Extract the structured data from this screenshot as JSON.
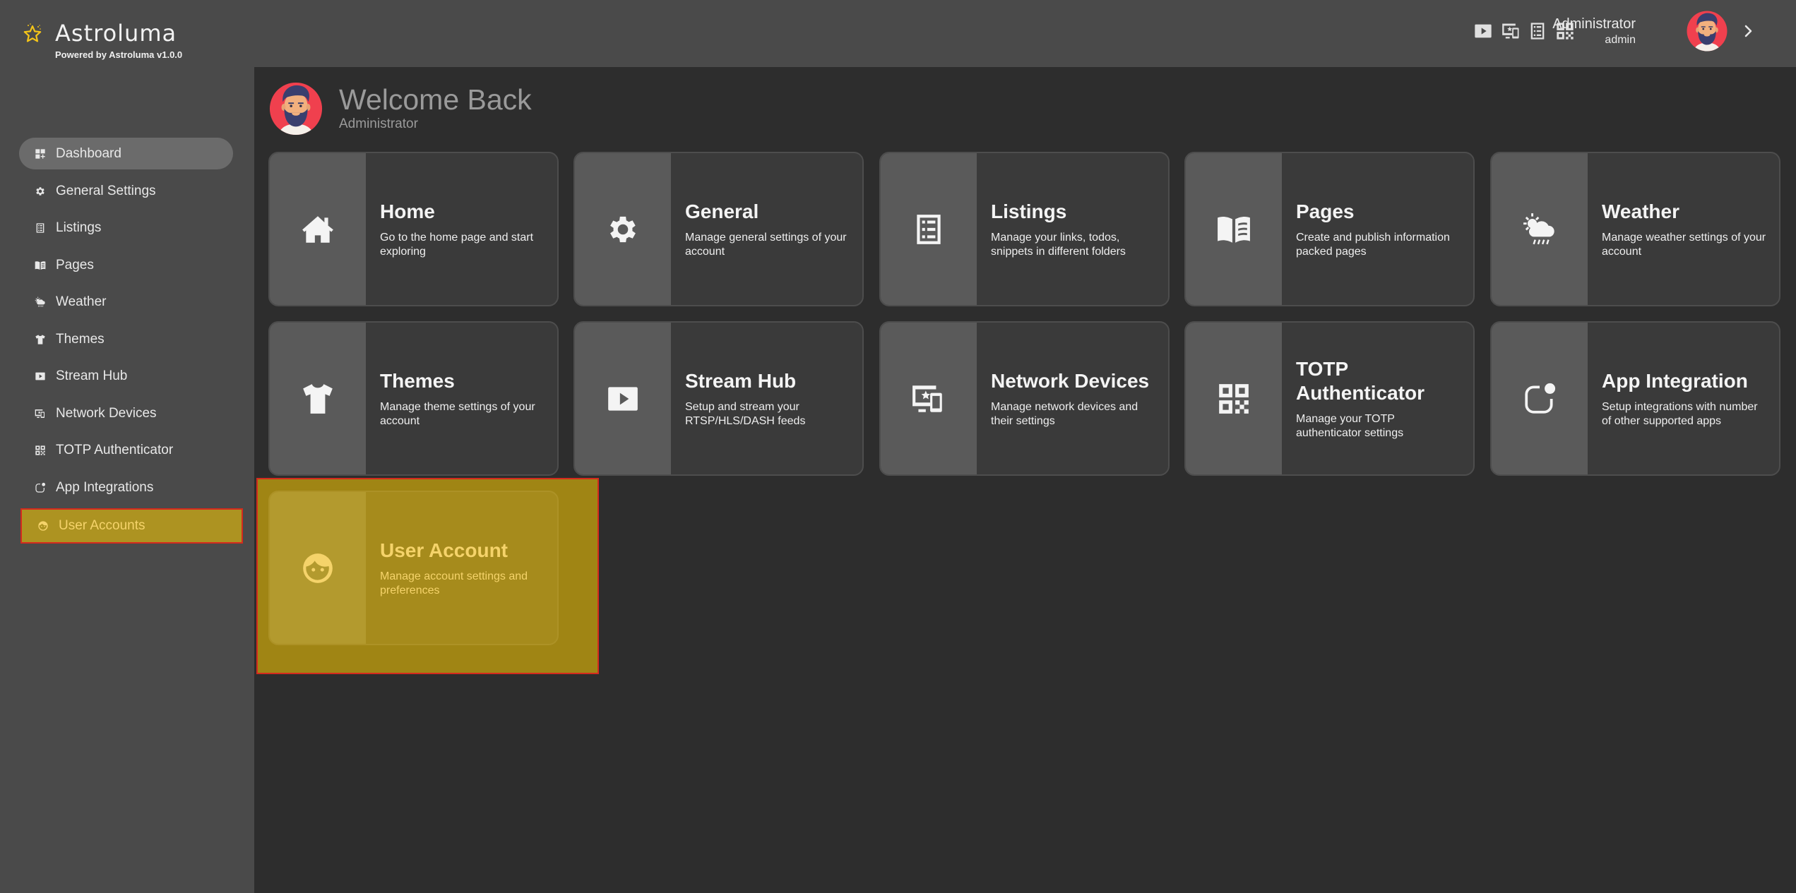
{
  "brand": {
    "title": "Astroluma",
    "subtitle": "Powered by Astroluma v1.0.0",
    "accent_color": "#f5c518"
  },
  "header": {
    "icons": [
      "stream-hub-icon",
      "network-devices-icon",
      "listings-icon",
      "qr-code-icon"
    ],
    "user_name": "Administrator",
    "user_role": "admin"
  },
  "sidebar": {
    "items": [
      {
        "label": "Dashboard",
        "icon": "dashboard-icon",
        "state": "active"
      },
      {
        "label": "General Settings",
        "icon": "gear-icon"
      },
      {
        "label": "Listings",
        "icon": "list-icon"
      },
      {
        "label": "Pages",
        "icon": "book-icon"
      },
      {
        "label": "Weather",
        "icon": "weather-icon"
      },
      {
        "label": "Themes",
        "icon": "tshirt-icon"
      },
      {
        "label": "Stream Hub",
        "icon": "play-icon"
      },
      {
        "label": "Network Devices",
        "icon": "devices-icon"
      },
      {
        "label": "TOTP Authenticator",
        "icon": "qr-code-icon"
      },
      {
        "label": "App Integrations",
        "icon": "app-integration-icon"
      },
      {
        "label": "User Accounts",
        "icon": "face-icon",
        "state": "highlighted"
      }
    ]
  },
  "welcome": {
    "title": "Welcome Back",
    "subtitle": "Administrator"
  },
  "cards": [
    {
      "title": "Home",
      "desc": "Go to the home page and start exploring",
      "icon": "home-icon"
    },
    {
      "title": "General",
      "desc": "Manage general settings of your account",
      "icon": "gear-icon"
    },
    {
      "title": "Listings",
      "desc": "Manage your links, todos, snippets in different folders",
      "icon": "list-icon"
    },
    {
      "title": "Pages",
      "desc": "Create and publish information packed pages",
      "icon": "book-icon"
    },
    {
      "title": "Weather",
      "desc": "Manage weather settings of your account",
      "icon": "weather-icon"
    },
    {
      "title": "Themes",
      "desc": "Manage theme settings of your account",
      "icon": "tshirt-icon"
    },
    {
      "title": "Stream Hub",
      "desc": "Setup and stream your RTSP/HLS/DASH feeds",
      "icon": "play-icon"
    },
    {
      "title": "Network Devices",
      "desc": "Manage network devices and their settings",
      "icon": "devices-icon"
    },
    {
      "title": "TOTP Authenticator",
      "desc": "Manage your TOTP authenticator settings",
      "icon": "qr-code-icon"
    },
    {
      "title": "App Integration",
      "desc": "Setup integrations with number of other supported apps",
      "icon": "app-integration-icon"
    },
    {
      "title": "User Account",
      "desc": "Manage account settings and preferences",
      "icon": "face-icon",
      "state": "highlighted"
    }
  ],
  "colors": {
    "highlight": "#ad9321",
    "highlight_border": "#d42a1e",
    "highlight_text": "#f5d36a"
  }
}
